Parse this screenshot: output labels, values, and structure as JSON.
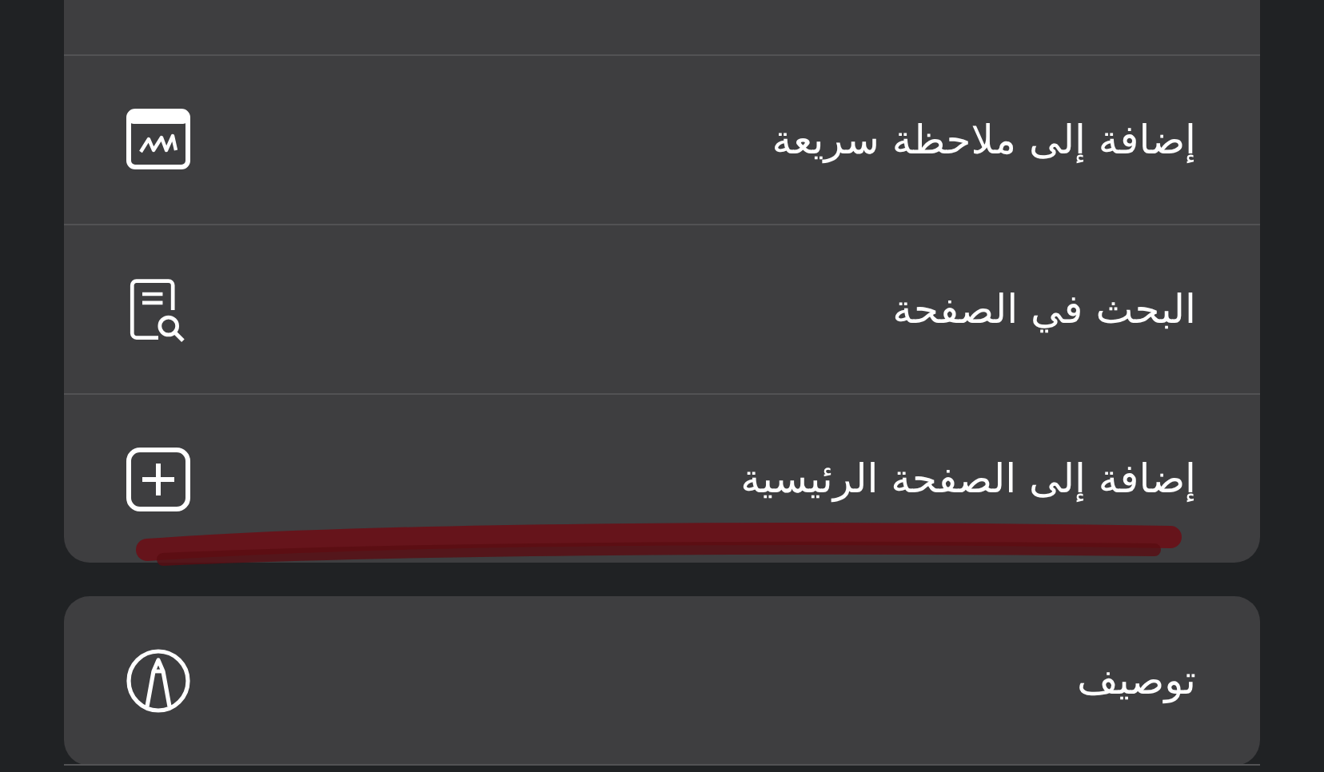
{
  "groups": [
    {
      "items": [
        {
          "label": "إضافة إلى ملاحظة سريعة",
          "kind": "quick-note"
        },
        {
          "label": "البحث في الصفحة",
          "kind": "find"
        },
        {
          "label": "إضافة إلى الصفحة الرئيسية",
          "kind": "add"
        }
      ]
    },
    {
      "items": [
        {
          "label": "توصيف",
          "kind": "markup"
        }
      ]
    }
  ]
}
